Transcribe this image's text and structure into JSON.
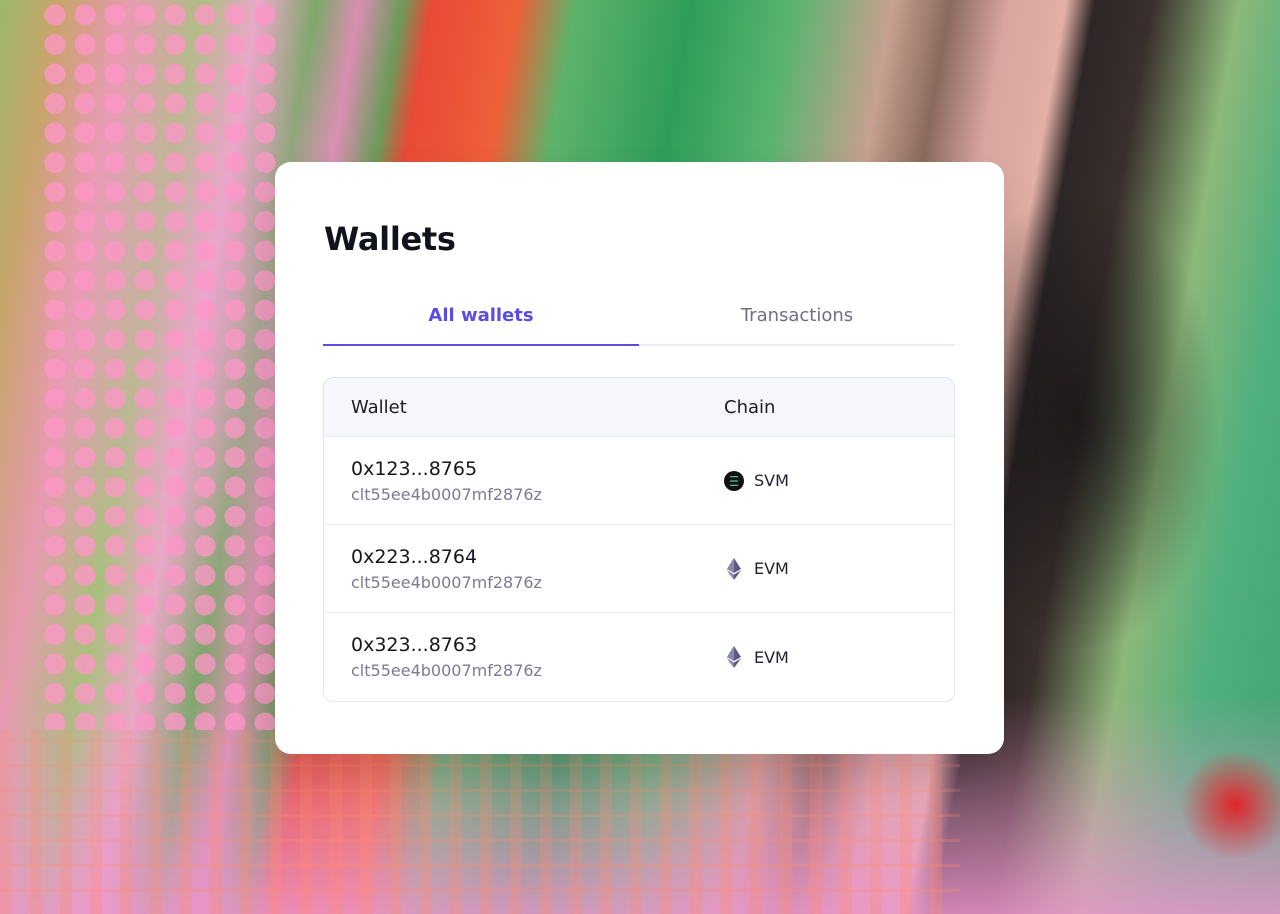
{
  "card": {
    "title": "Wallets"
  },
  "tabs": [
    {
      "label": "All wallets",
      "active": true
    },
    {
      "label": "Transactions",
      "active": false
    }
  ],
  "table": {
    "columns": [
      "Wallet",
      "Chain"
    ],
    "rows": [
      {
        "address": "0x123...8765",
        "id": "clt55ee4b0007mf2876z",
        "chain": "SVM",
        "chain_icon": "solana-icon"
      },
      {
        "address": "0x223...8764",
        "id": "clt55ee4b0007mf2876z",
        "chain": "EVM",
        "chain_icon": "ethereum-icon"
      },
      {
        "address": "0x323...8763",
        "id": "clt55ee4b0007mf2876z",
        "chain": "EVM",
        "chain_icon": "ethereum-icon"
      }
    ]
  },
  "colors": {
    "accent": "#5b4de0",
    "text_primary": "#16161e",
    "text_secondary": "#7c7b92",
    "header_bg": "#f6f7fb"
  }
}
